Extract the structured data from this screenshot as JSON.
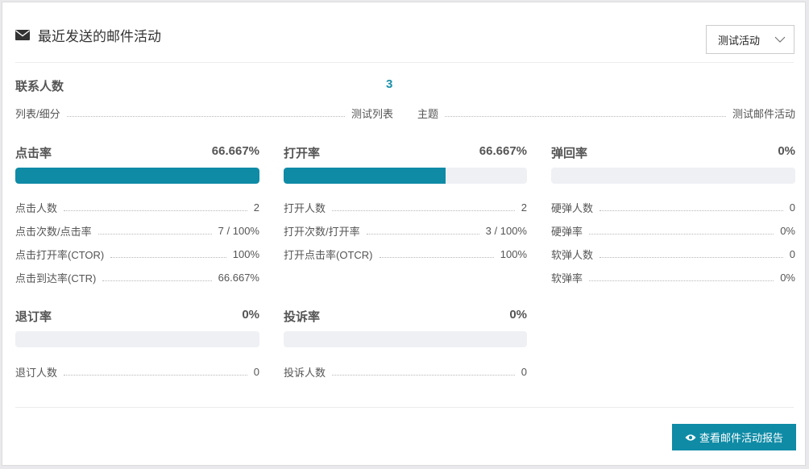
{
  "header": {
    "title": "最近发送的邮件活动",
    "icon": "envelope-icon"
  },
  "campaign_select": {
    "value": "测试活动"
  },
  "contacts": {
    "label": "联系人数",
    "value": "3"
  },
  "meta": {
    "list_label": "列表/细分",
    "list_value": "测试列表",
    "subject_label": "主题",
    "subject_value": "测试邮件活动"
  },
  "stats": {
    "click": {
      "title": "点击率",
      "pct": "66.667%",
      "fill": 1.0,
      "rows": [
        {
          "label": "点击人数",
          "value": "2"
        },
        {
          "label": "点击次数/点击率",
          "value": "7 / 100%"
        },
        {
          "label": "点击打开率(CTOR)",
          "value": "100%"
        },
        {
          "label": "点击到达率(CTR)",
          "value": "66.667%"
        }
      ]
    },
    "open": {
      "title": "打开率",
      "pct": "66.667%",
      "fill": 0.66667,
      "rows": [
        {
          "label": "打开人数",
          "value": "2"
        },
        {
          "label": "打开次数/打开率",
          "value": "3 / 100%"
        },
        {
          "label": "打开点击率(OTCR)",
          "value": "100%"
        }
      ]
    },
    "bounce": {
      "title": "弹回率",
      "pct": "0%",
      "fill": 0,
      "rows": [
        {
          "label": "硬弹人数",
          "value": "0"
        },
        {
          "label": "硬弹率",
          "value": "0%"
        },
        {
          "label": "软弹人数",
          "value": "0"
        },
        {
          "label": "软弹率",
          "value": "0%"
        }
      ]
    },
    "unsubscribe": {
      "title": "退订率",
      "pct": "0%",
      "fill": 0,
      "rows": [
        {
          "label": "退订人数",
          "value": "0"
        }
      ]
    },
    "complaint": {
      "title": "投诉率",
      "pct": "0%",
      "fill": 0,
      "rows": [
        {
          "label": "投诉人数",
          "value": "0"
        }
      ]
    }
  },
  "report_button": {
    "label": "查看邮件活动报告",
    "icon": "eye-icon"
  },
  "colors": {
    "accent": "#0f8ba6",
    "bar_track": "#eff0f4",
    "contact_value": "#1a8fa8"
  }
}
